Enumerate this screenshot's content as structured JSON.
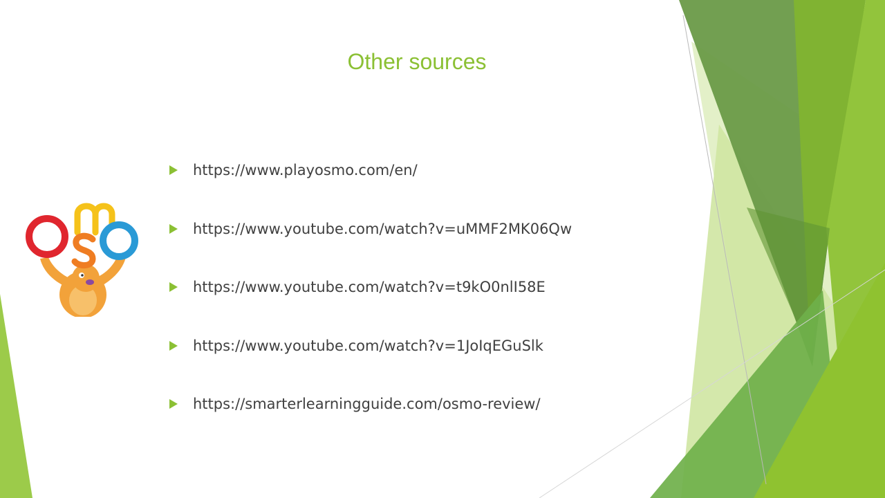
{
  "slide": {
    "title": "Other sources",
    "accent_color": "#8bc034",
    "links": [
      "https://www.playosmo.com/en/",
      "https://www.youtube.com/watch?v=uMMF2MK06Qw",
      "https://www.youtube.com/watch?v=t9kO0nlI58E",
      "https://www.youtube.com/watch?v=1JoIqEGuSlk",
      "https://smarterlearningguide.com/osmo-review/"
    ]
  },
  "logo": {
    "icon": "osmo-mascot-logo",
    "letters": [
      "o",
      "m",
      "s",
      "o"
    ]
  }
}
